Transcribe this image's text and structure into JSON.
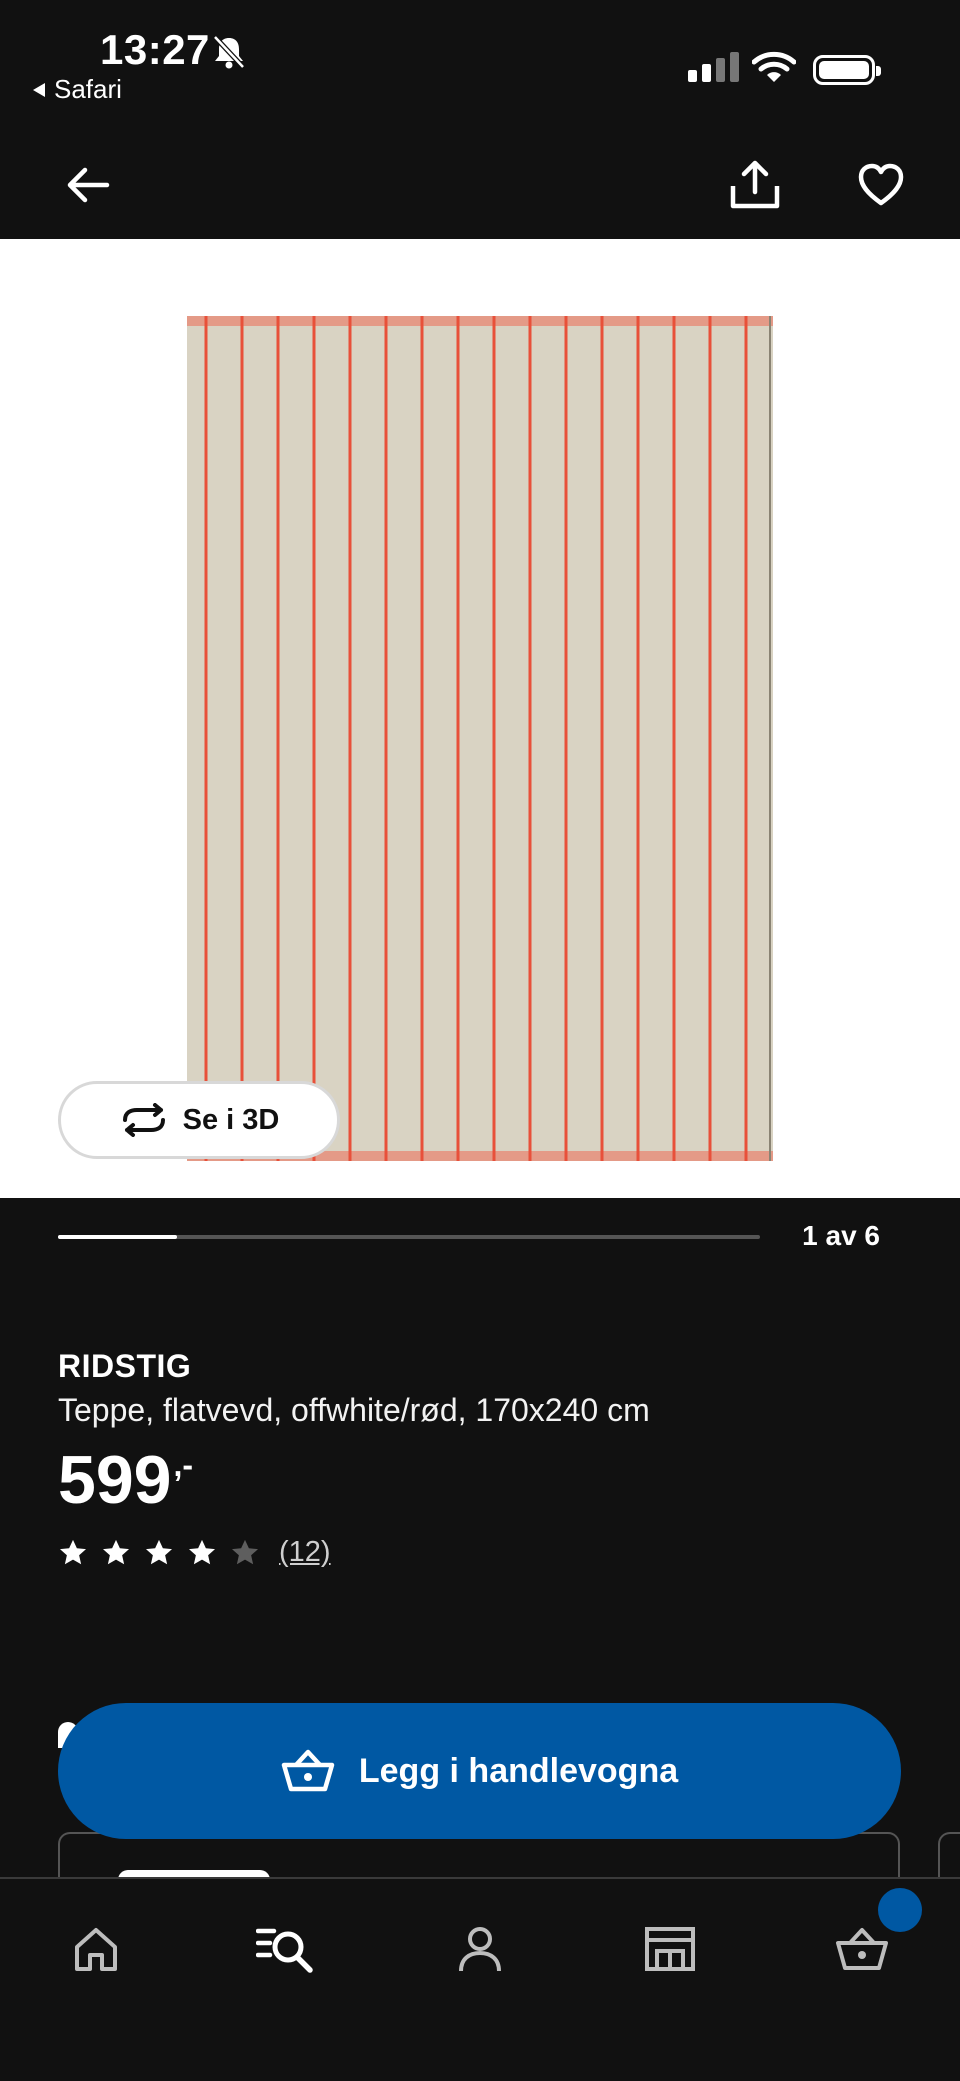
{
  "status_bar": {
    "time": "13:27",
    "back_app": "Safari"
  },
  "product": {
    "brand": "RIDSTIG",
    "description": "Teppe, flatvevd, offwhite/rød, 170x240 cm",
    "price": "599",
    "price_suffix": ",-",
    "rating": 4,
    "rating_max": 5,
    "review_count": "(12)"
  },
  "gallery": {
    "view_3d_label": "Se i 3D",
    "counter": "1 av 6",
    "progress": 0.17
  },
  "actions": {
    "add_to_cart_label": "Legg i handlevogna"
  },
  "colors": {
    "background": "#111111",
    "accent_blue": "#0058a3",
    "rug_base": "#d9d3c3",
    "rug_stripe": "#e8503a"
  },
  "icons": {
    "nav": [
      "back-arrow-icon",
      "share-icon",
      "heart-icon"
    ],
    "tabs": [
      "home-icon",
      "search-icon",
      "profile-icon",
      "store-icon",
      "cart-icon"
    ]
  }
}
